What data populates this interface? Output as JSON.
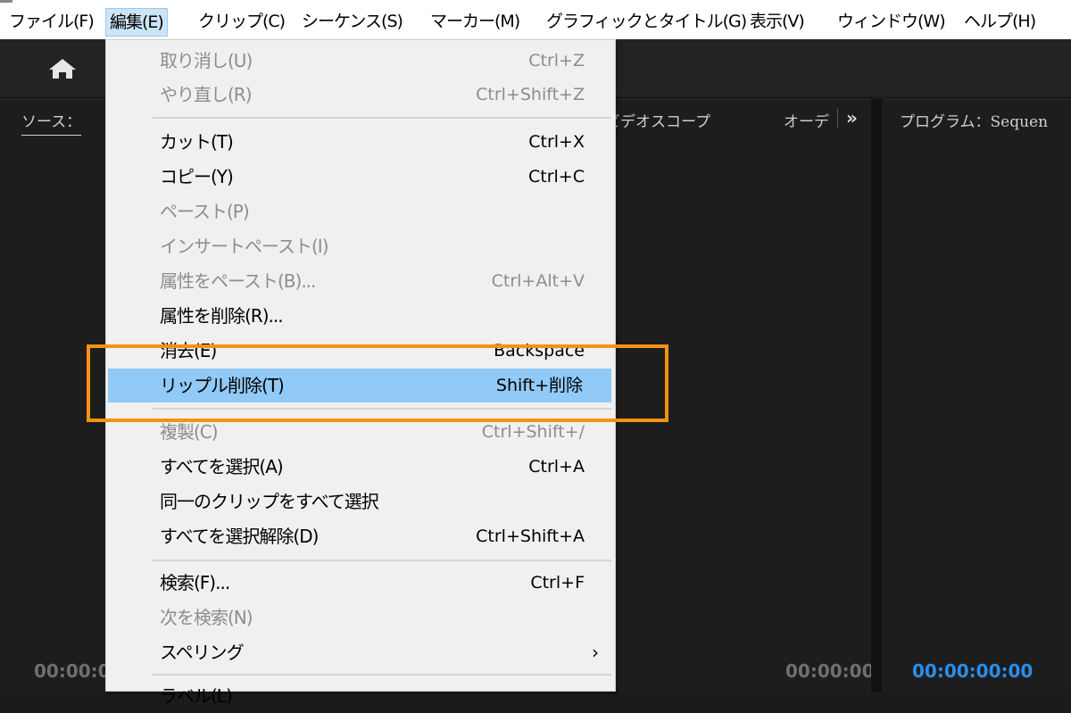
{
  "menubar": {
    "items": [
      {
        "label": "ファイル(F)"
      },
      {
        "label": "編集(E)"
      },
      {
        "label": "クリップ(C)"
      },
      {
        "label": "シーケンス(S)"
      },
      {
        "label": "マーカー(M)"
      },
      {
        "label": "グラフィックとタイトル(G)"
      },
      {
        "label": "表示(V)"
      },
      {
        "label": "ウィンドウ(W)"
      },
      {
        "label": "ヘルプ(H)"
      }
    ]
  },
  "toolbar": {
    "home_icon": "home-icon"
  },
  "panels": {
    "source_tab": "ソース：",
    "scopes_tab": "ビデオスコープ",
    "audio_tab": "オーデ",
    "more_icon": "chevron-double-right-icon",
    "program_tab": "プログラム：Sequen",
    "source_timecode": "00:00:0",
    "mid_timecode": "00:00:00",
    "program_timecode": "00:00:00:00"
  },
  "edit_menu": {
    "items": [
      {
        "label": "取り消し(U)",
        "shortcut": "Ctrl+Z",
        "enabled": false
      },
      {
        "label": "やり直し(R)",
        "shortcut": "Ctrl+Shift+Z",
        "enabled": false
      },
      {
        "label": "カット(T)",
        "shortcut": "Ctrl+X",
        "enabled": true
      },
      {
        "label": "コピー(Y)",
        "shortcut": "Ctrl+C",
        "enabled": true
      },
      {
        "label": "ペースト(P)",
        "shortcut": "",
        "enabled": false
      },
      {
        "label": "インサートペースト(I)",
        "shortcut": "",
        "enabled": false
      },
      {
        "label": "属性をペースト(B)...",
        "shortcut": "Ctrl+Alt+V",
        "enabled": false
      },
      {
        "label": "属性を削除(R)...",
        "shortcut": "",
        "enabled": true
      },
      {
        "label": "消去(E)",
        "shortcut": "Backspace",
        "enabled": true
      },
      {
        "label": "リップル削除(T)",
        "shortcut": "Shift+削除",
        "enabled": true,
        "highlighted": true
      },
      {
        "label": "複製(C)",
        "shortcut": "Ctrl+Shift+/",
        "enabled": false
      },
      {
        "label": "すべてを選択(A)",
        "shortcut": "Ctrl+A",
        "enabled": true
      },
      {
        "label": "同一のクリップをすべて選択",
        "shortcut": "",
        "enabled": true
      },
      {
        "label": "すべてを選択解除(D)",
        "shortcut": "Ctrl+Shift+A",
        "enabled": true
      },
      {
        "label": "検索(F)...",
        "shortcut": "Ctrl+F",
        "enabled": true
      },
      {
        "label": "次を検索(N)",
        "shortcut": "",
        "enabled": false
      },
      {
        "label": "スペリング",
        "shortcut": "",
        "enabled": true,
        "submenu": true
      },
      {
        "label": "ラベル(L)",
        "shortcut": "",
        "enabled": true
      }
    ]
  },
  "colors": {
    "highlight": "#91c9f7",
    "annotation": "#f39214",
    "timecode_active": "#2d8ceb"
  }
}
